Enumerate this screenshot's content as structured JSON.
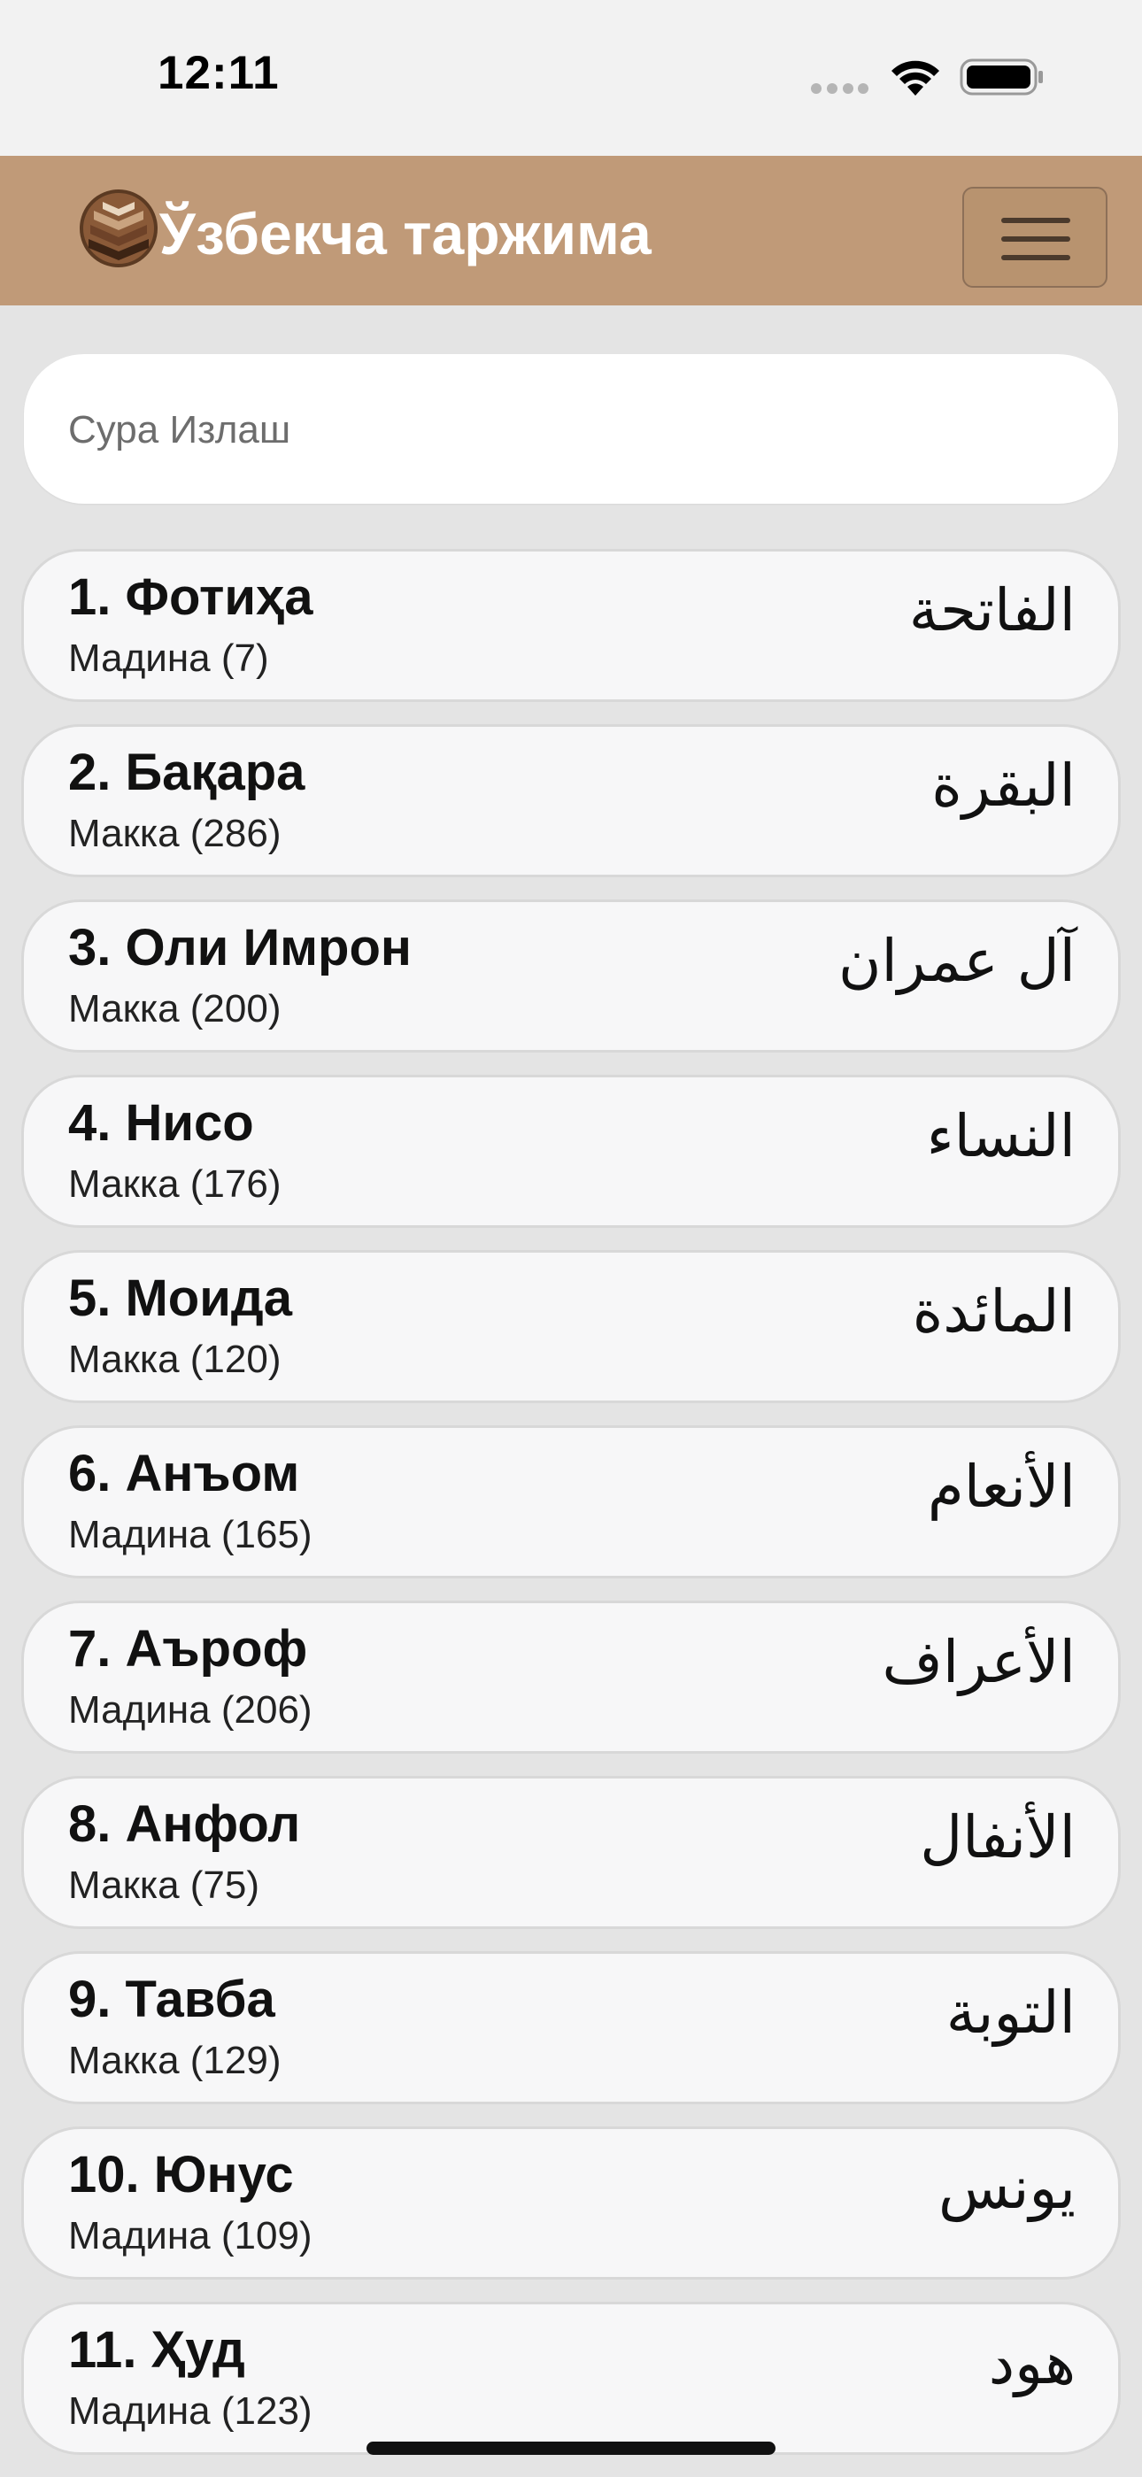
{
  "status_bar": {
    "time": "12:11"
  },
  "navbar": {
    "title": "Ўзбекча таржима",
    "logo_icon": "book-stack-icon",
    "menu_icon": "hamburger-menu-icon",
    "background_color": "#c09a78"
  },
  "search": {
    "placeholder": "Сура Излаш",
    "value": ""
  },
  "suras": [
    {
      "name": "1. Фотиҳа",
      "meta": "Мадина (7)",
      "arabic": "الفاتحة"
    },
    {
      "name": "2. Бақара",
      "meta": "Макка (286)",
      "arabic": "البقرة"
    },
    {
      "name": "3. Оли Имрон",
      "meta": "Макка (200)",
      "arabic": "آل عمران"
    },
    {
      "name": "4. Нисо",
      "meta": "Макка (176)",
      "arabic": "النساء"
    },
    {
      "name": "5. Моида",
      "meta": "Макка (120)",
      "arabic": "المائدة"
    },
    {
      "name": "6. Анъом",
      "meta": "Мадина (165)",
      "arabic": "الأنعام"
    },
    {
      "name": "7. Аъроф",
      "meta": "Мадина (206)",
      "arabic": "الأعراف"
    },
    {
      "name": "8. Анфол",
      "meta": "Макка (75)",
      "arabic": "الأنفال"
    },
    {
      "name": "9. Тавба",
      "meta": "Макка (129)",
      "arabic": "التوبة"
    },
    {
      "name": "10. Юнус",
      "meta": "Мадина (109)",
      "arabic": "يونس"
    },
    {
      "name": "11. Ҳуд",
      "meta": "Мадина (123)",
      "arabic": "هود"
    }
  ]
}
